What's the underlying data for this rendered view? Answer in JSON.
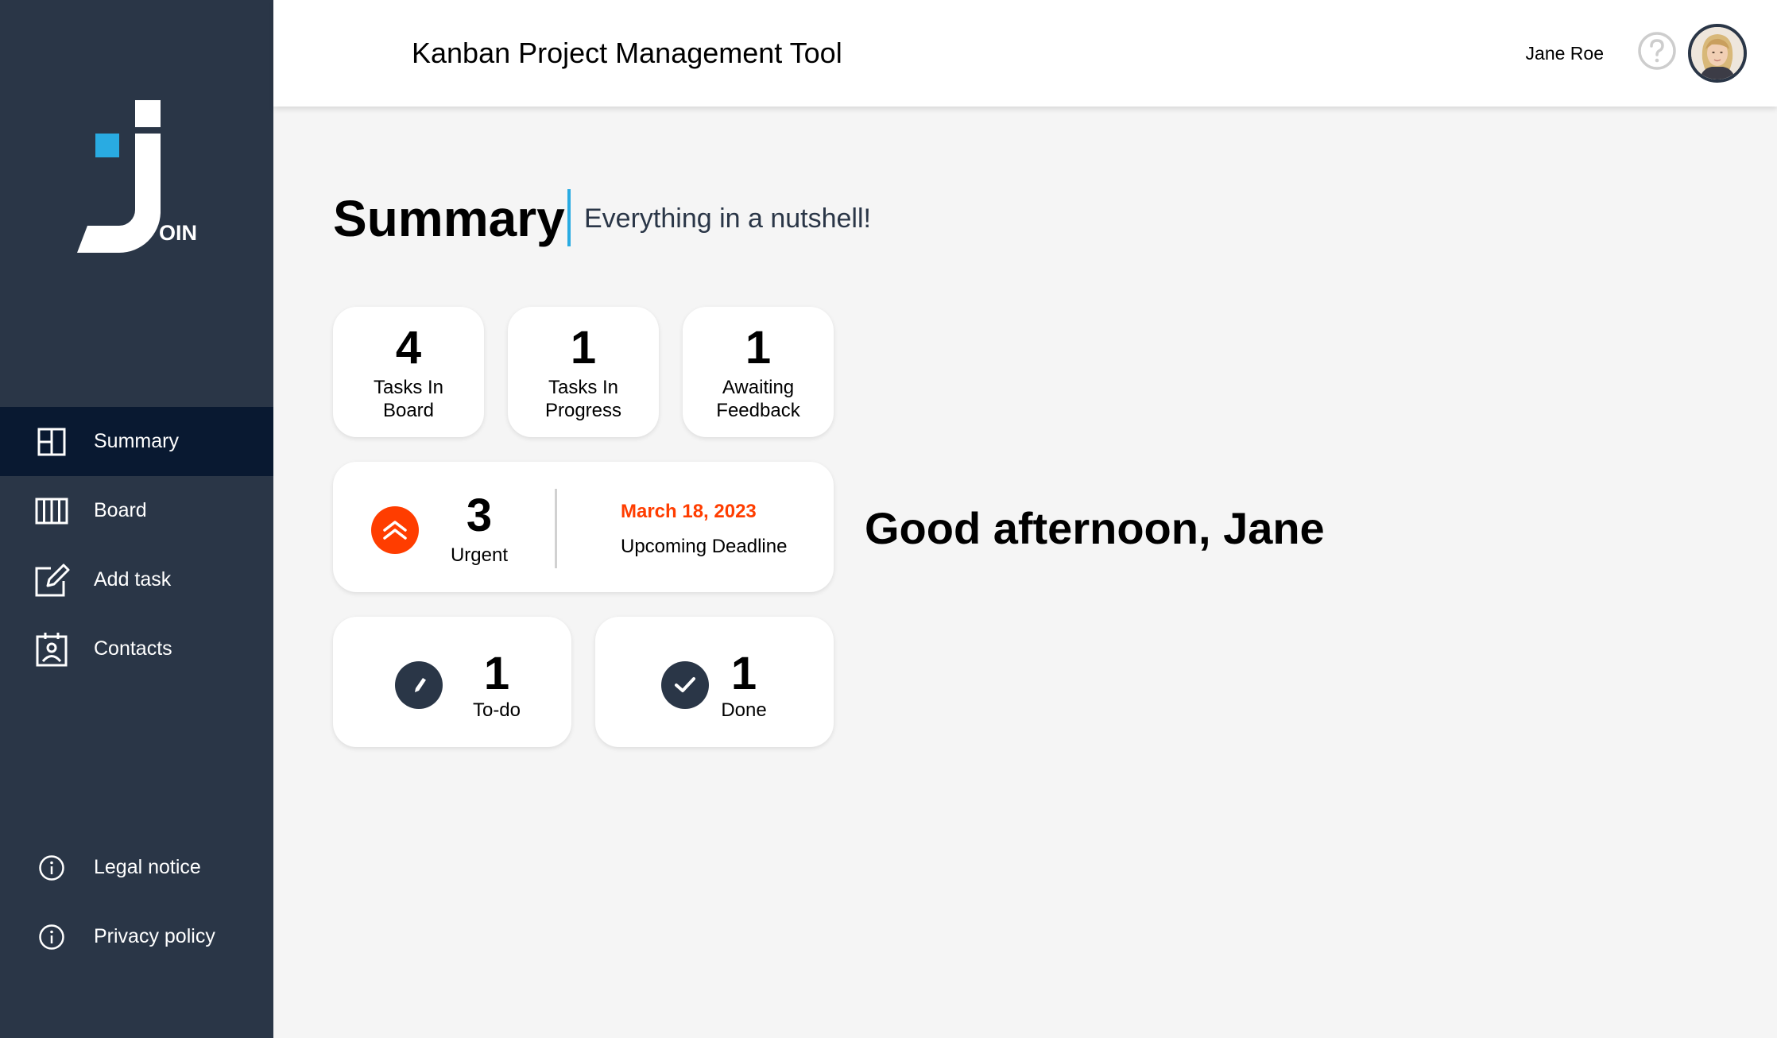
{
  "app": {
    "title": "Kanban Project Management Tool",
    "logo_text": "OIN"
  },
  "header": {
    "user_name": "Jane Roe",
    "help_icon": "question-circle-icon",
    "avatar_icon": "user-avatar"
  },
  "sidebar": {
    "items": [
      {
        "label": "Summary",
        "icon": "summary-icon",
        "active": true
      },
      {
        "label": "Board",
        "icon": "board-icon",
        "active": false
      },
      {
        "label": "Add task",
        "icon": "add-task-icon",
        "active": false
      },
      {
        "label": "Contacts",
        "icon": "contacts-icon",
        "active": false
      }
    ],
    "bottom_items": [
      {
        "label": "Legal notice",
        "icon": "info-icon"
      },
      {
        "label": "Privacy policy",
        "icon": "info-icon"
      }
    ]
  },
  "summary": {
    "title": "Summary",
    "subtitle": "Everything in a nutshell!",
    "tasks_in_board": {
      "value": "4",
      "label": "Tasks In Board"
    },
    "tasks_in_progress": {
      "value": "1",
      "label": "Tasks In Progress"
    },
    "awaiting_feedback": {
      "value": "1",
      "label": "Awaiting Feedback"
    },
    "urgent": {
      "value": "3",
      "label": "Urgent",
      "icon": "urgent-chevrons-icon"
    },
    "deadline": {
      "date": "March 18, 2023",
      "label": "Upcoming Deadline"
    },
    "todo": {
      "value": "1",
      "label": "To-do",
      "icon": "pencil-icon"
    },
    "done": {
      "value": "1",
      "label": "Done",
      "icon": "check-icon"
    }
  },
  "greeting": "Good afternoon, Jane",
  "colors": {
    "sidebar": "#2a3647",
    "sidebar_active": "#091931",
    "accent": "#29abe2",
    "urgent": "#ff3d00"
  }
}
